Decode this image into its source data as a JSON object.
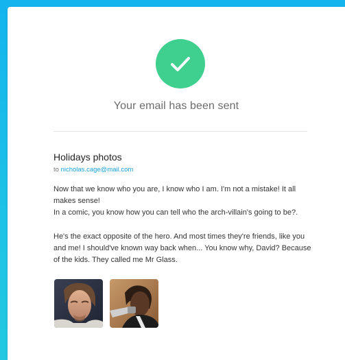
{
  "status": {
    "icon": "checkmark-icon",
    "message": "Your email has been sent",
    "color": "#3fcf8e"
  },
  "email": {
    "subject": "Holidays photos",
    "to_prefix": "to",
    "to_address": "nicholas.cage@mail.com",
    "body": [
      "Now that we know who you are, I know who I am. I'm not a mistake! It all makes sense!",
      "In a comic, you know how you can tell who the arch-villain's going to be?.",
      "He's the exact opposite of the hero. And most times they're friends, like you and me! I should've known way back when... You know why, David? Because of the kids. They called me Mr Glass."
    ],
    "attachments": [
      "photo-thumbnail",
      "photo-thumbnail"
    ]
  },
  "colors": {
    "background": "#14b4ee",
    "accent": "#1aa0d8",
    "success": "#3fcf8e"
  }
}
